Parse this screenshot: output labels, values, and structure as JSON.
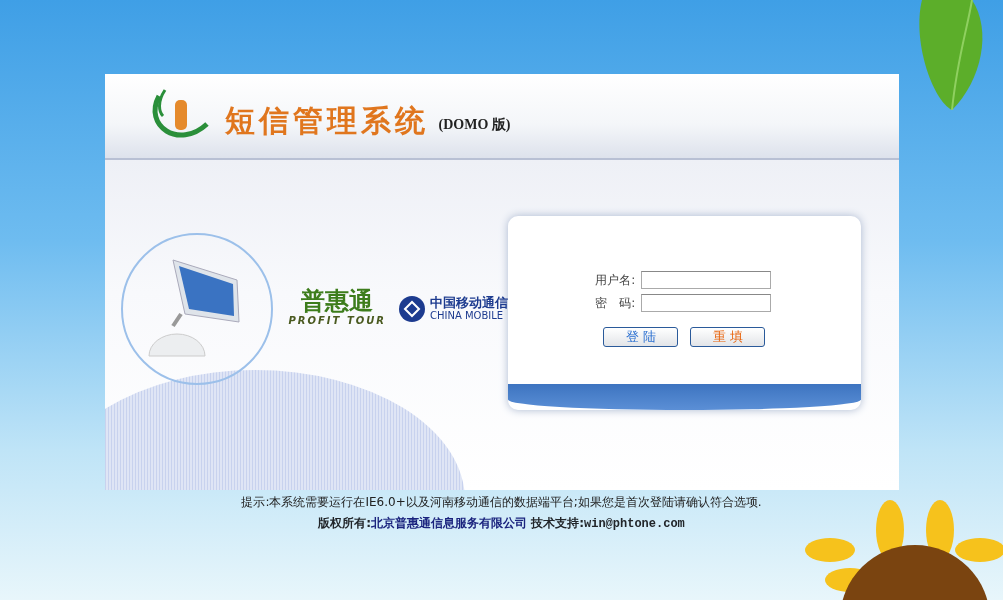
{
  "header": {
    "title": "短信管理系统",
    "edition": "(DOMO 版)"
  },
  "partners": [
    {
      "kind": "profit",
      "name": "普惠通",
      "tagline": "PROFIT TOUR"
    },
    {
      "kind": "mobile",
      "name": "中国移动通信",
      "tagline": "CHINA MOBILE"
    }
  ],
  "login": {
    "fields": [
      {
        "label": "用户名:"
      },
      {
        "label": "密　码:"
      }
    ],
    "buttons": [
      {
        "label": "登 陆",
        "kind": "submit"
      },
      {
        "label": "重 填",
        "kind": "reset"
      }
    ]
  },
  "footer": {
    "notice": "提示:本系统需要运行在IE6.0+以及河南移动通信的数据端平台;如果您是首次登陆请确认符合选项.",
    "copyright_label": "版权所有:",
    "company": "北京普惠通信息服务有限公司",
    "support_label": "技术支持:",
    "email": "win@phtone.com"
  }
}
